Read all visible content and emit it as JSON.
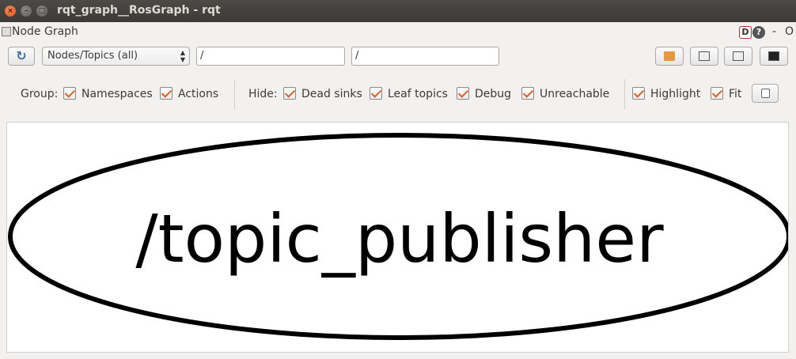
{
  "window": {
    "title": "rqt_graph__RosGraph - rqt",
    "close_glyph": "×",
    "min_glyph": "–",
    "max_glyph": "□"
  },
  "plugin": {
    "title": "Node Graph",
    "d_label": "D",
    "help_label": "?",
    "dash_label": "-",
    "o_label": "O"
  },
  "toolbar": {
    "refresh_icon": "refresh-icon",
    "graph_type": "Nodes/Topics (all)",
    "namespace_filter": "/",
    "topic_filter": "/",
    "buttons": [
      "load-dot-icon",
      "save-dot-icon",
      "save-svg-icon",
      "save-image-icon"
    ]
  },
  "options": {
    "group_label": "Group:",
    "namespaces_label": "Namespaces",
    "actions_label": "Actions",
    "hide_label": "Hide:",
    "dead_sinks_label": "Dead sinks",
    "leaf_topics_label": "Leaf topics",
    "debug_label": "Debug",
    "unreachable_label": "Unreachable",
    "highlight_label": "Highlight",
    "fit_label": "Fit",
    "checked": {
      "namespaces": true,
      "actions": true,
      "dead_sinks": true,
      "leaf_topics": true,
      "debug": true,
      "unreachable": true,
      "highlight": true,
      "fit": true
    }
  },
  "graph": {
    "nodes": [
      {
        "label": "/topic_publisher",
        "shape": "ellipse"
      }
    ]
  },
  "colors": {
    "check_accent": "#e0622c",
    "titlebar": "#3c3b37",
    "close_button": "#e0531d"
  }
}
